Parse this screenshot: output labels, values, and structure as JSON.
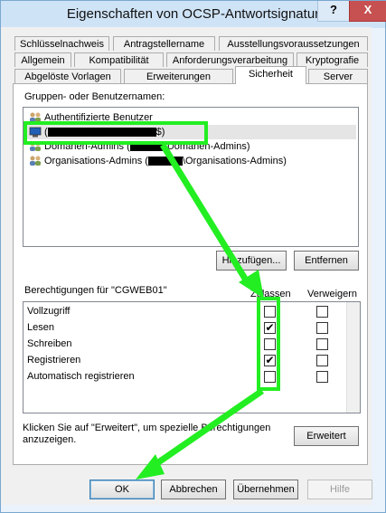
{
  "window": {
    "title": "Eigenschaften von OCSP-Antwortsignatur",
    "help_label": "?",
    "close_label": "X"
  },
  "tabs": {
    "row1": [
      "Schlüsselnachweis",
      "Antragstellername",
      "Ausstellungsvoraussetzungen"
    ],
    "row2": [
      "Allgemein",
      "Kompatibilität",
      "Anforderungsverarbeitung",
      "Kryptografie"
    ],
    "row3": [
      "Abgelöste Vorlagen",
      "Erweiterungen",
      "Sicherheit",
      "Server"
    ],
    "selected": "Sicherheit"
  },
  "groups": {
    "label": "Gruppen- oder Benutzernamen:",
    "items": [
      {
        "name": "Authentifizierte Benutzer"
      },
      {
        "prefix": "(",
        "suffix": "$)"
      },
      {
        "prefix": "Domänen-Admins (",
        "suffix": "\\Domänen-Admins)"
      },
      {
        "prefix": "Organisations-Admins (",
        "suffix": "\\Organisations-Admins)"
      }
    ],
    "add_button": "Hinzufügen...",
    "remove_button": "Entfernen"
  },
  "permissions": {
    "label": "Berechtigungen für \"CGWEB01\"",
    "allow_header": "Zulassen",
    "deny_header": "Verweigern",
    "rows": [
      {
        "name": "Vollzugriff",
        "allow": false,
        "deny": false
      },
      {
        "name": "Lesen",
        "allow": true,
        "deny": false
      },
      {
        "name": "Schreiben",
        "allow": false,
        "deny": false
      },
      {
        "name": "Registrieren",
        "allow": true,
        "deny": false
      },
      {
        "name": "Automatisch registrieren",
        "allow": false,
        "deny": false
      }
    ]
  },
  "advanced": {
    "hint": "Klicken Sie auf \"Erweitert\", um spezielle Berechtigungen anzuzeigen.",
    "button": "Erweitert"
  },
  "footer": {
    "ok": "OK",
    "cancel": "Abbrechen",
    "apply": "Übernehmen",
    "help": "Hilfe"
  },
  "colors": {
    "annotation": "#22ee22",
    "close": "#c75050",
    "titlebar": "#cfe3f6"
  }
}
